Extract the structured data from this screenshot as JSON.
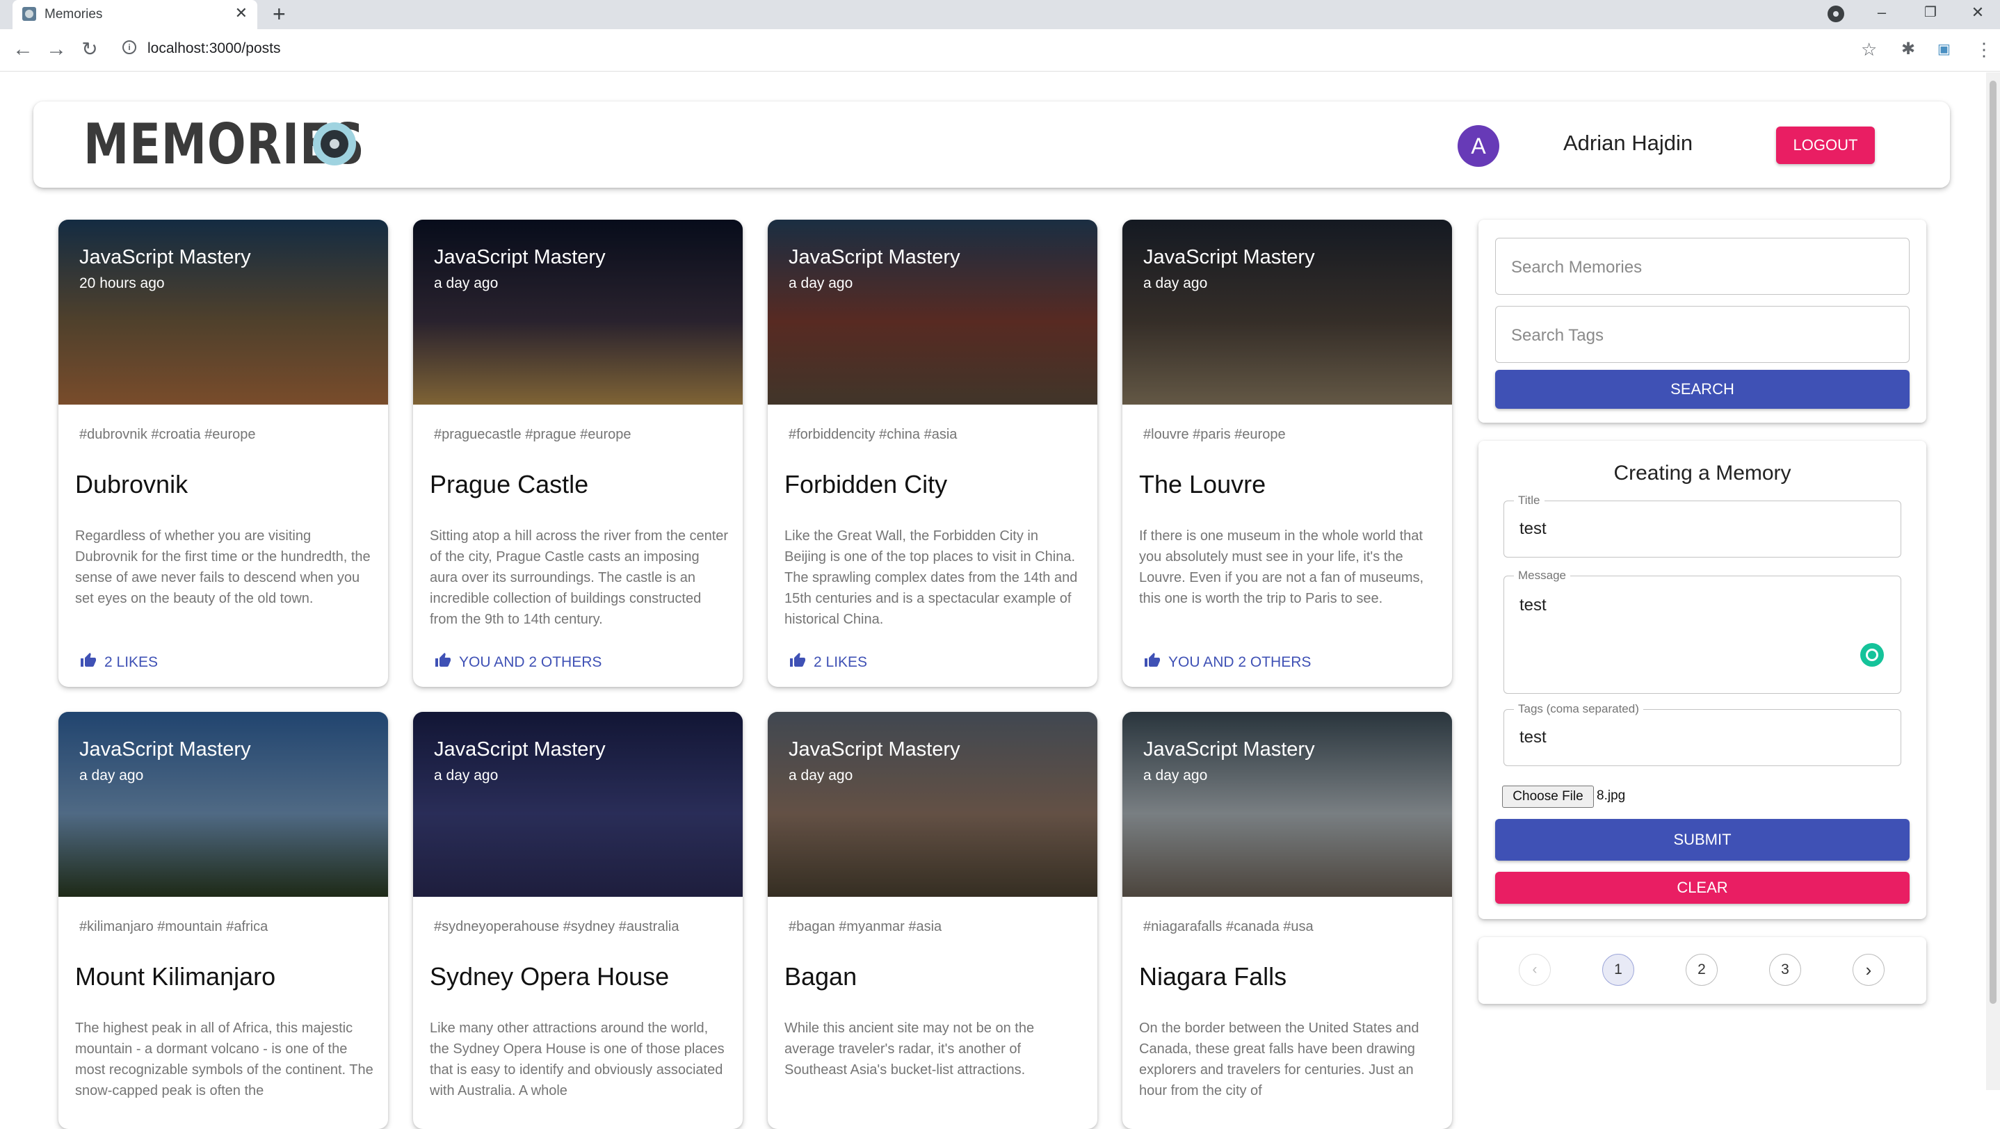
{
  "browser": {
    "tab_title": "Memories",
    "url": "localhost:3000/posts"
  },
  "appbar": {
    "brand": "MEMORIES",
    "avatar_letter": "A",
    "username": "Adrian Hajdin",
    "logout_label": "LOGOUT"
  },
  "posts": [
    {
      "author": "JavaScript Mastery",
      "time": "20 hours ago",
      "tags": "#dubrovnik #croatia #europe",
      "title": "Dubrovnik",
      "message": "Regardless of whether you are visiting Dubrovnik for the first time or the hundredth, the sense of awe never fails to descend when you set eyes on the beauty of the old town.",
      "likes": "2 LIKES"
    },
    {
      "author": "JavaScript Mastery",
      "time": "a day ago",
      "tags": "#praguecastle #prague #europe",
      "title": "Prague Castle",
      "message": "Sitting atop a hill across the river from the center of the city, Prague Castle casts an imposing aura over its surroundings. The castle is an incredible collection of buildings constructed from the 9th to 14th century.",
      "likes": "YOU AND 2 OTHERS"
    },
    {
      "author": "JavaScript Mastery",
      "time": "a day ago",
      "tags": "#forbiddencity #china #asia",
      "title": "Forbidden City",
      "message": "Like the Great Wall, the Forbidden City in Beijing is one of the top places to visit in China. The sprawling complex dates from the 14th and 15th centuries and is a spectacular example of historical China.",
      "likes": "2 LIKES"
    },
    {
      "author": "JavaScript Mastery",
      "time": "a day ago",
      "tags": "#louvre #paris #europe",
      "title": "The Louvre",
      "message": "If there is one museum in the whole world that you absolutely must see in your life, it's the Louvre. Even if you are not a fan of museums, this one is worth the trip to Paris to see.",
      "likes": "YOU AND 2 OTHERS"
    },
    {
      "author": "JavaScript Mastery",
      "time": "a day ago",
      "tags": "#kilimanjaro #mountain #africa",
      "title": "Mount Kilimanjaro",
      "message": "The highest peak in all of Africa, this majestic mountain - a dormant volcano - is one of the most recognizable symbols of the continent. The snow-capped peak is often the",
      "likes": ""
    },
    {
      "author": "JavaScript Mastery",
      "time": "a day ago",
      "tags": "#sydneyoperahouse #sydney #australia",
      "title": "Sydney Opera House",
      "message": "Like many other attractions around the world, the Sydney Opera House is one of those places that is easy to identify and obviously associated with Australia. A whole",
      "likes": ""
    },
    {
      "author": "JavaScript Mastery",
      "time": "a day ago",
      "tags": "#bagan #myanmar #asia",
      "title": "Bagan",
      "message": "While this ancient site may not be on the average traveler's radar, it's another of Southeast Asia's bucket-list attractions.",
      "likes": ""
    },
    {
      "author": "JavaScript Mastery",
      "time": "a day ago",
      "tags": "#niagarafalls #canada #usa",
      "title": "Niagara Falls",
      "message": "On the border between the United States and Canada, these great falls have been drawing explorers and travelers for centuries. Just an hour from the city of",
      "likes": ""
    }
  ],
  "search": {
    "memories_placeholder": "Search Memories",
    "tags_placeholder": "Search Tags",
    "button": "SEARCH"
  },
  "form": {
    "heading": "Creating a Memory",
    "title_label": "Title",
    "title_value": "test",
    "message_label": "Message",
    "message_value": "test",
    "tags_label": "Tags (coma separated)",
    "tags_value": "test",
    "choose_file": "Choose File",
    "file_name": "8.jpg",
    "submit": "SUBMIT",
    "clear": "CLEAR"
  },
  "pagination": {
    "pages": [
      "1",
      "2",
      "3"
    ],
    "current": "1"
  },
  "colors": {
    "primary": "#3f51b5",
    "secondary": "#e91e63",
    "avatar": "#673ab7"
  }
}
